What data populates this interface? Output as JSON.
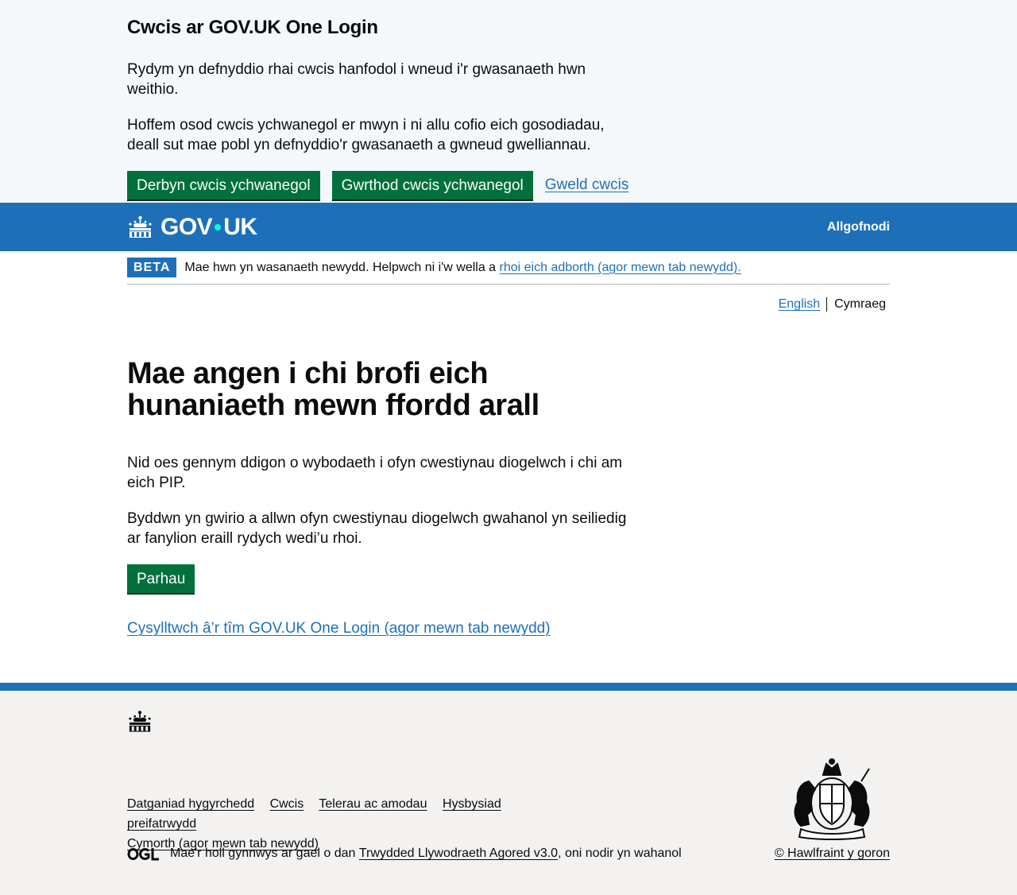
{
  "cookie_banner": {
    "title": "Cwcis ar GOV.UK One Login",
    "para1": "Rydym yn defnyddio rhai cwcis hanfodol i wneud i'r gwasanaeth hwn weithio.",
    "para2": "Hoffem osod cwcis ychwanegol er mwyn i ni allu cofio eich gosodiadau, deall sut mae pobl yn defnyddio'r gwasanaeth a gwneud gwelliannau.",
    "accept_label": "Derbyn cwcis ychwanegol",
    "reject_label": "Gwrthod cwcis ychwanegol",
    "view_label": "Gweld cwcis"
  },
  "header": {
    "logo_gov": "GOV",
    "logo_uk": "UK",
    "signout_label": "Allgofnodi"
  },
  "phase_banner": {
    "tag": "BETA",
    "text": "Mae hwn yn wasanaeth newydd. Helpwch ni i'w wella a ",
    "link": "rhoi eich adborth (agor mewn tab newydd)."
  },
  "language": {
    "english": "English",
    "welsh": "Cymraeg"
  },
  "main": {
    "heading": "Mae angen i chi brofi eich hunaniaeth mewn ffordd arall",
    "para1": "Nid oes gennym ddigon o wybodaeth i ofyn cwestiynau diogelwch i chi am eich PIP.",
    "para2": "Byddwn yn gwirio a allwn ofyn cwestiynau diogelwch gwahanol yn seiliedig ar fanylion eraill rydych wedi’u rhoi.",
    "continue_label": "Parhau",
    "contact_link": "Cysylltwch â’r tîm GOV.UK One Login (agor mewn tab newydd)"
  },
  "footer": {
    "links": [
      "Datganiad hygyrchedd",
      "Cwcis",
      "Telerau ac amodau",
      "Hysbysiad preifatrwydd",
      "Cymorth (agor mewn tab newydd)"
    ],
    "license_prefix": "Mae'r holl gynnwys ar gael o dan ",
    "license_link": "Trwydded Llywodraeth Agored v3.0",
    "license_suffix": ", oni nodir yn wahanol",
    "copyright": "© Hawlfraint y goron",
    "ogl_logo_text": "OGL"
  },
  "colors": {
    "brand_blue": "#1d70b8",
    "button_green": "#00703c",
    "link": "#1d70b8",
    "footer_bg": "#f3f2f1",
    "cookie_bg": "#f4f8fb"
  }
}
